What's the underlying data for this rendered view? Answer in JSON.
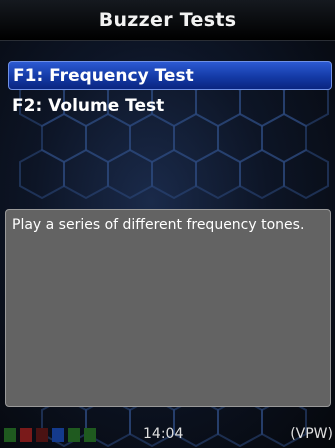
{
  "title": "Buzzer Tests",
  "menu": {
    "items": [
      {
        "label": "F1: Frequency Test",
        "selected": true
      },
      {
        "label": "F2: Volume Test",
        "selected": false
      }
    ]
  },
  "description": "Play a series of different frequency tones.",
  "status_bar": {
    "time": "14:04",
    "mode": "(VPW)",
    "indicator_colors": [
      "#1f5a1f",
      "#7a1a1a",
      "#4a1212",
      "#143a8c",
      "#1f5a1f",
      "#1f5a1f"
    ]
  },
  "colors": {
    "selection": "#1f45b8",
    "panel": "#636363"
  }
}
